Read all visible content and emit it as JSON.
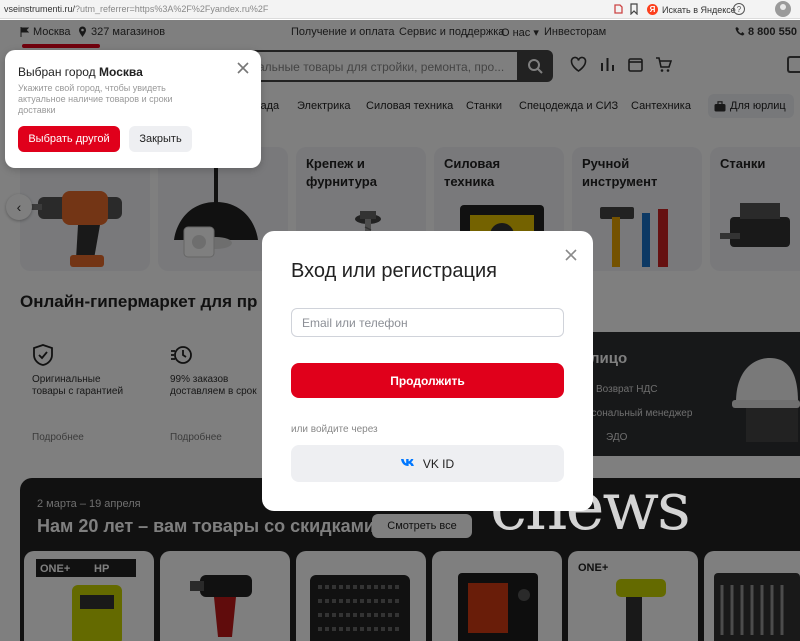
{
  "browser": {
    "url_host": "vseinstrumenti.ru/",
    "url_query": "?utm_referrer=https%3A%2F%2Fyandex.ru%2F",
    "yandex_search_label": "Искать в Яндексе",
    "yandex_logo_letter": "Я",
    "help_glyph": "?"
  },
  "topbar": {
    "city": "Москва",
    "stores": "327 магазинов",
    "links": [
      "Получение и оплата",
      "Сервис и поддержка",
      "О нас ▾",
      "Инвесторам"
    ],
    "phone": "8 800 550"
  },
  "search": {
    "placeholder": "альные товары для стройки, ремонта, про..."
  },
  "nav": {
    "items": [
      "сада",
      "Электрика",
      "Силовая техника",
      "Станки",
      "Спецодежда и СИЗ",
      "Сантехника"
    ],
    "business": "Для юрлиц"
  },
  "categories": [
    {
      "title": ""
    },
    {
      "title": ""
    },
    {
      "title_line1": "Крепеж и",
      "title_line2": "фурнитура"
    },
    {
      "title_line1": "Силовая",
      "title_line2": "техника"
    },
    {
      "title_line1": "Ручной",
      "title_line2": "инструмент"
    },
    {
      "title_line1": "Станки",
      "title_line2": ""
    }
  ],
  "hypermarket": {
    "title": "Онлайн-гипермаркет для пр",
    "advantages": [
      {
        "line1": "Оригинальные",
        "line2": "товары с гарантией",
        "more": "Подробнее"
      },
      {
        "line1": "99% заказов",
        "line2": "доставляем в срок",
        "more": "Подробнее"
      }
    ]
  },
  "business_card": {
    "title": "лицо",
    "lines": [
      "Возврат НДС",
      "рсональный менеджер",
      "ЭДО"
    ]
  },
  "promo": {
    "date": "2 марта – 19 апреля",
    "title": "Нам 20 лет – вам товары со скидками",
    "button": "Смотреть все",
    "brand1": "ONE+",
    "brand2": "HP",
    "brand3": "ONE+"
  },
  "watermark": "cnews",
  "city_popup": {
    "title_prefix": "Выбран город ",
    "city": "Москва",
    "description": "Укажите свой город, чтобы увидеть актуальное наличие товаров и сроки доставки",
    "choose_button": "Выбрать другой",
    "close_button": "Закрыть"
  },
  "login_modal": {
    "title": "Вход или регистрация",
    "input_placeholder": "Email или телефон",
    "input_value": "",
    "continue_button": "Продолжить",
    "or_text": "или войдите через",
    "vk_button": "VK ID"
  },
  "colors": {
    "accent_red": "#e0001b",
    "dark": "#232323",
    "vk_blue": "#0077ff"
  },
  "icons": [
    "flag-icon",
    "pin-icon",
    "phone-icon",
    "search-icon",
    "heart-icon",
    "compare-icon",
    "orders-icon",
    "cart-icon",
    "close-icon",
    "chevron-left-icon",
    "shield-check-icon",
    "fast-clock-icon",
    "vk-icon",
    "briefcase-icon"
  ]
}
